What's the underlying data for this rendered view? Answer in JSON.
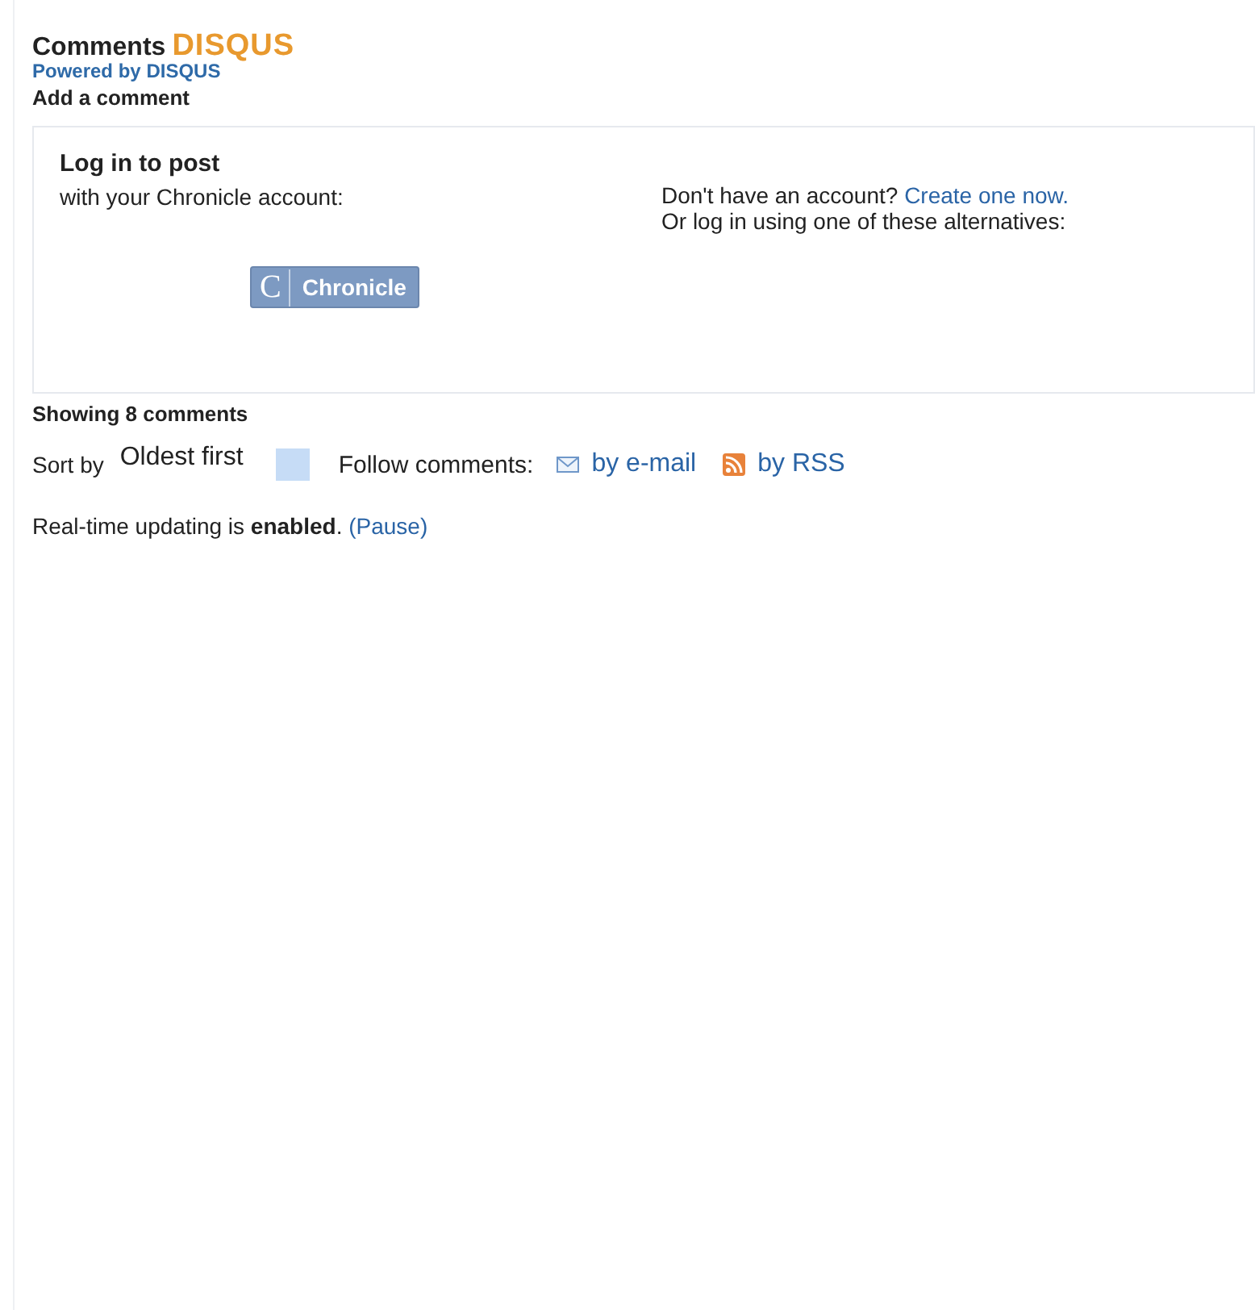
{
  "header": {
    "title": "Comments",
    "logo": "DISQUS",
    "powered_by": "Powered by DISQUS",
    "add_comment": "Add a comment"
  },
  "login": {
    "title": "Log in to post",
    "subtitle": "with your Chronicle account:",
    "button_letter": "C",
    "button_label": "Chronicle",
    "no_account": "Don't have an account?",
    "create_link": "Create one now.",
    "alternatives": "Or log in using one of these alternatives:"
  },
  "count": "Showing 8 comments",
  "sort": {
    "label": "Sort by",
    "value": "Oldest first"
  },
  "follow": {
    "label": "Follow comments:",
    "links": [
      {
        "kind": "email",
        "label": "by e-mail"
      },
      {
        "kind": "rss",
        "label": "by RSS"
      }
    ]
  },
  "realtime": {
    "text": "Real-time updating is **enabled**.",
    "link": "(Pause)"
  }
}
